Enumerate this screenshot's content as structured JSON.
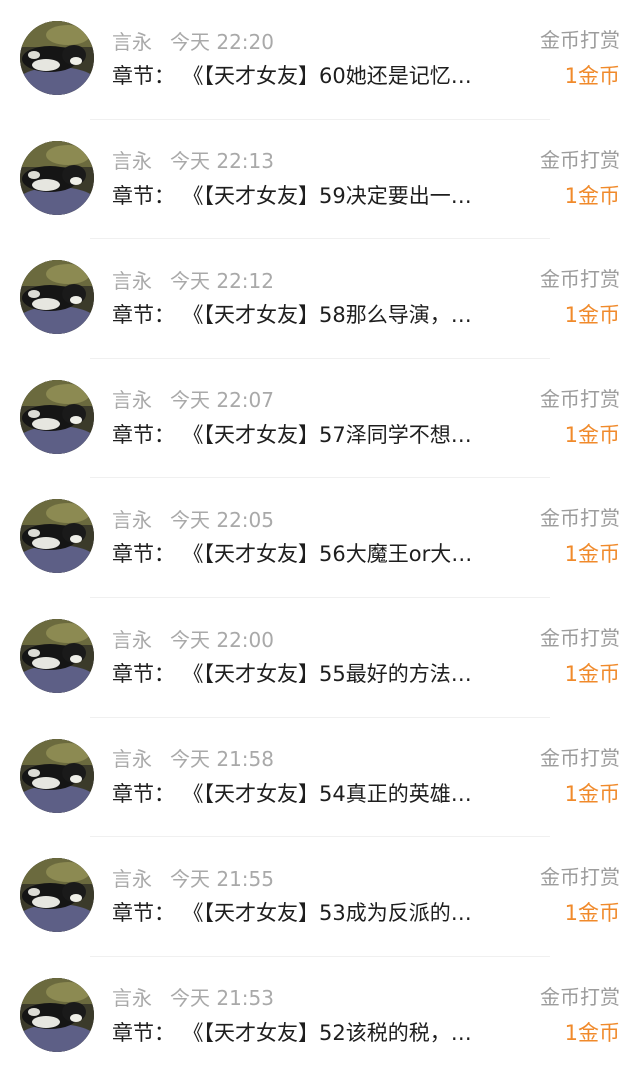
{
  "chapter_prefix": "章节：",
  "records": [
    {
      "user": "言永",
      "time": "今天 22:20",
      "type": "金币打赏",
      "chapter": "《【天才女友】60她还是记忆…",
      "amount": "1金币"
    },
    {
      "user": "言永",
      "time": "今天 22:13",
      "type": "金币打赏",
      "chapter": "《【天才女友】59决定要出一…",
      "amount": "1金币"
    },
    {
      "user": "言永",
      "time": "今天 22:12",
      "type": "金币打赏",
      "chapter": "《【天才女友】58那么导演，…",
      "amount": "1金币"
    },
    {
      "user": "言永",
      "time": "今天 22:07",
      "type": "金币打赏",
      "chapter": "《【天才女友】57泽同学不想…",
      "amount": "1金币"
    },
    {
      "user": "言永",
      "time": "今天 22:05",
      "type": "金币打赏",
      "chapter": "《【天才女友】56大魔王or大…",
      "amount": "1金币"
    },
    {
      "user": "言永",
      "time": "今天 22:00",
      "type": "金币打赏",
      "chapter": "《【天才女友】55最好的方法…",
      "amount": "1金币"
    },
    {
      "user": "言永",
      "time": "今天 21:58",
      "type": "金币打赏",
      "chapter": "《【天才女友】54真正的英雄…",
      "amount": "1金币"
    },
    {
      "user": "言永",
      "time": "今天 21:55",
      "type": "金币打赏",
      "chapter": "《【天才女友】53成为反派的…",
      "amount": "1金币"
    },
    {
      "user": "言永",
      "time": "今天 21:53",
      "type": "金币打赏",
      "chapter": "《【天才女友】52该税的税，…",
      "amount": "1金币"
    }
  ],
  "colors": {
    "meta_text": "#a9a9a9",
    "primary_text": "#1e1e1e",
    "accent_orange": "#f08a2b",
    "divider": "#f0f0f0"
  }
}
